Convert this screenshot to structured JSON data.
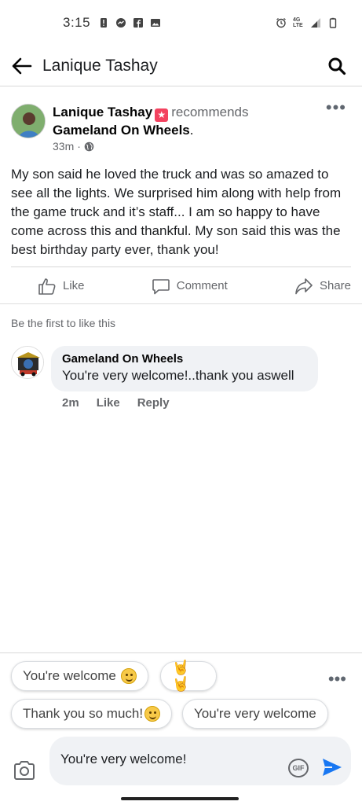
{
  "status_bar": {
    "time": "3:15",
    "network": "4G LTE"
  },
  "app_bar": {
    "title": "Lanique Tashay",
    "back_icon": "arrow-left-icon",
    "search_icon": "search-icon"
  },
  "post": {
    "author": "Lanique Tashay",
    "action": "recommends",
    "page": "Gameland On Wheels",
    "page_suffix": ".",
    "time": "33m",
    "privacy_icon": "globe-icon",
    "body": "My son said he loved the truck and was so amazed to see all the lights. We surprised him along with help from the game truck and it’s staff... I am so happy to have come across this and thankful. My son said this was the best birthday party ever, thank you!",
    "actions": {
      "like": "Like",
      "comment": "Comment",
      "share": "Share"
    }
  },
  "likes_text": "Be the first to like this",
  "comment": {
    "author": "Gameland On Wheels",
    "text": "You're very welcome!..thank you aswell",
    "time": "2m",
    "like": "Like",
    "reply": "Reply"
  },
  "quick_replies": {
    "chip1": "You're welcome",
    "chip2": "🤘🤘",
    "chip3": "Thank you so much!",
    "chip4": "You're very welcome"
  },
  "composer": {
    "text": "You're very welcome!",
    "gif_label": "GIF"
  },
  "colors": {
    "accent": "#1877f2",
    "badge": "#f3425f",
    "secondary_text": "#65676b",
    "bubble": "#f0f2f5"
  }
}
